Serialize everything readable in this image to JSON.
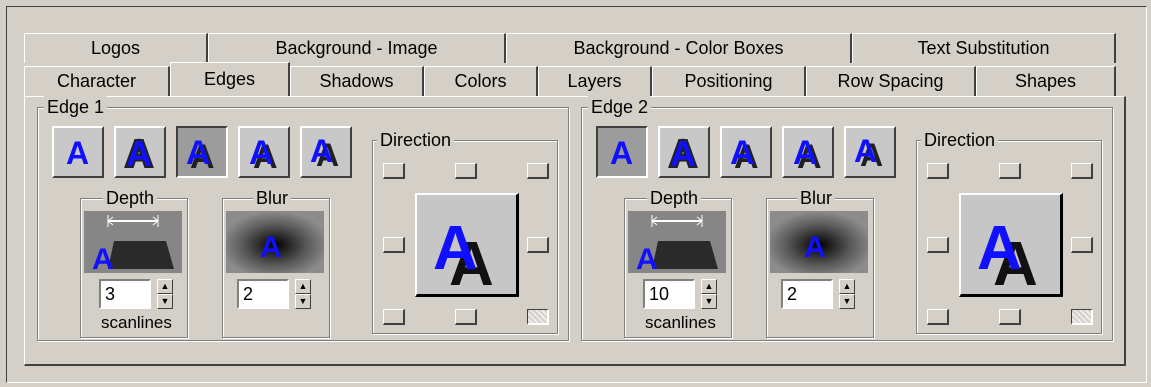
{
  "tabs_row1": [
    {
      "label": "Logos"
    },
    {
      "label": "Background - Image"
    },
    {
      "label": "Background - Color Boxes"
    },
    {
      "label": "Text Substitution"
    }
  ],
  "tabs_row2": [
    {
      "label": "Character"
    },
    {
      "label": "Edges"
    },
    {
      "label": "Shadows"
    },
    {
      "label": "Colors"
    },
    {
      "label": "Layers"
    },
    {
      "label": "Positioning"
    },
    {
      "label": "Row Spacing"
    },
    {
      "label": "Shapes"
    }
  ],
  "active_tab": "Edges",
  "preview_glyph": "A",
  "edge1": {
    "title": "Edge 1",
    "selected_style": 3,
    "depth_label": "Depth",
    "depth_value": "3",
    "depth_unit": "scanlines",
    "blur_label": "Blur",
    "blur_value": "2",
    "direction_label": "Direction",
    "direction_selected": "bottom-right"
  },
  "edge2": {
    "title": "Edge 2",
    "selected_style": 1,
    "depth_label": "Depth",
    "depth_value": "10",
    "depth_unit": "scanlines",
    "blur_label": "Blur",
    "blur_value": "2",
    "direction_label": "Direction",
    "direction_selected": "bottom-right"
  },
  "colors": {
    "glyph": "#1010ff",
    "shadow": "#202020",
    "button_face": "#d4d0c8"
  }
}
